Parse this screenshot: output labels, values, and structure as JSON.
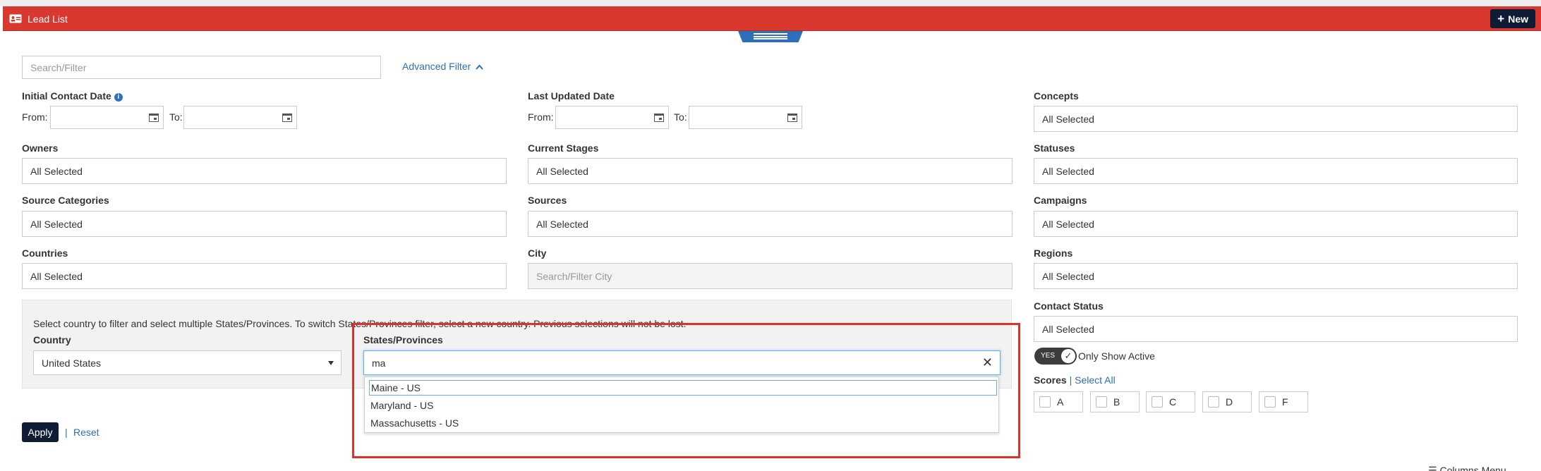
{
  "header": {
    "title": "Lead List",
    "new_label": "New"
  },
  "search": {
    "placeholder": "Search/Filter"
  },
  "advanced_filter": {
    "label": "Advanced Filter"
  },
  "initial_contact": {
    "label": "Initial Contact Date",
    "from": "From:",
    "to": "To:"
  },
  "last_updated": {
    "label": "Last Updated Date",
    "from": "From:",
    "to": "To:"
  },
  "filters": {
    "concepts": {
      "label": "Concepts",
      "value": "All Selected"
    },
    "owners": {
      "label": "Owners",
      "value": "All Selected"
    },
    "current_stages": {
      "label": "Current Stages",
      "value": "All Selected"
    },
    "statuses": {
      "label": "Statuses",
      "value": "All Selected"
    },
    "source_categories": {
      "label": "Source Categories",
      "value": "All Selected"
    },
    "sources": {
      "label": "Sources",
      "value": "All Selected"
    },
    "campaigns": {
      "label": "Campaigns",
      "value": "All Selected"
    },
    "countries": {
      "label": "Countries",
      "value": "All Selected"
    },
    "city": {
      "label": "City",
      "placeholder": "Search/Filter City"
    },
    "regions": {
      "label": "Regions",
      "value": "All Selected"
    },
    "contact_status": {
      "label": "Contact Status",
      "value": "All Selected"
    }
  },
  "state_panel": {
    "note": "Select country to filter and select multiple States/Provinces. To switch States/Provinces filter, select a new country. Previous selections will not be lost.",
    "country_label": "Country",
    "country_value": "United States",
    "states_label": "States/Provinces",
    "states_query": "ma",
    "options": [
      "Maine - US",
      "Maryland - US",
      "Massachusetts - US"
    ]
  },
  "toggle": {
    "state": "YES",
    "label": "Only Show Active"
  },
  "scores": {
    "label": "Scores",
    "select_all": "Select All",
    "grades": [
      "A",
      "B",
      "C",
      "D",
      "F"
    ]
  },
  "actions": {
    "apply": "Apply",
    "separator": "|",
    "reset": "Reset"
  },
  "columns_menu": {
    "label": "Columns Menu"
  },
  "colors": {
    "header_red": "#d9382f",
    "navy": "#0f1c35",
    "link_blue": "#2f6fba",
    "highlight_red": "#e0302b"
  }
}
